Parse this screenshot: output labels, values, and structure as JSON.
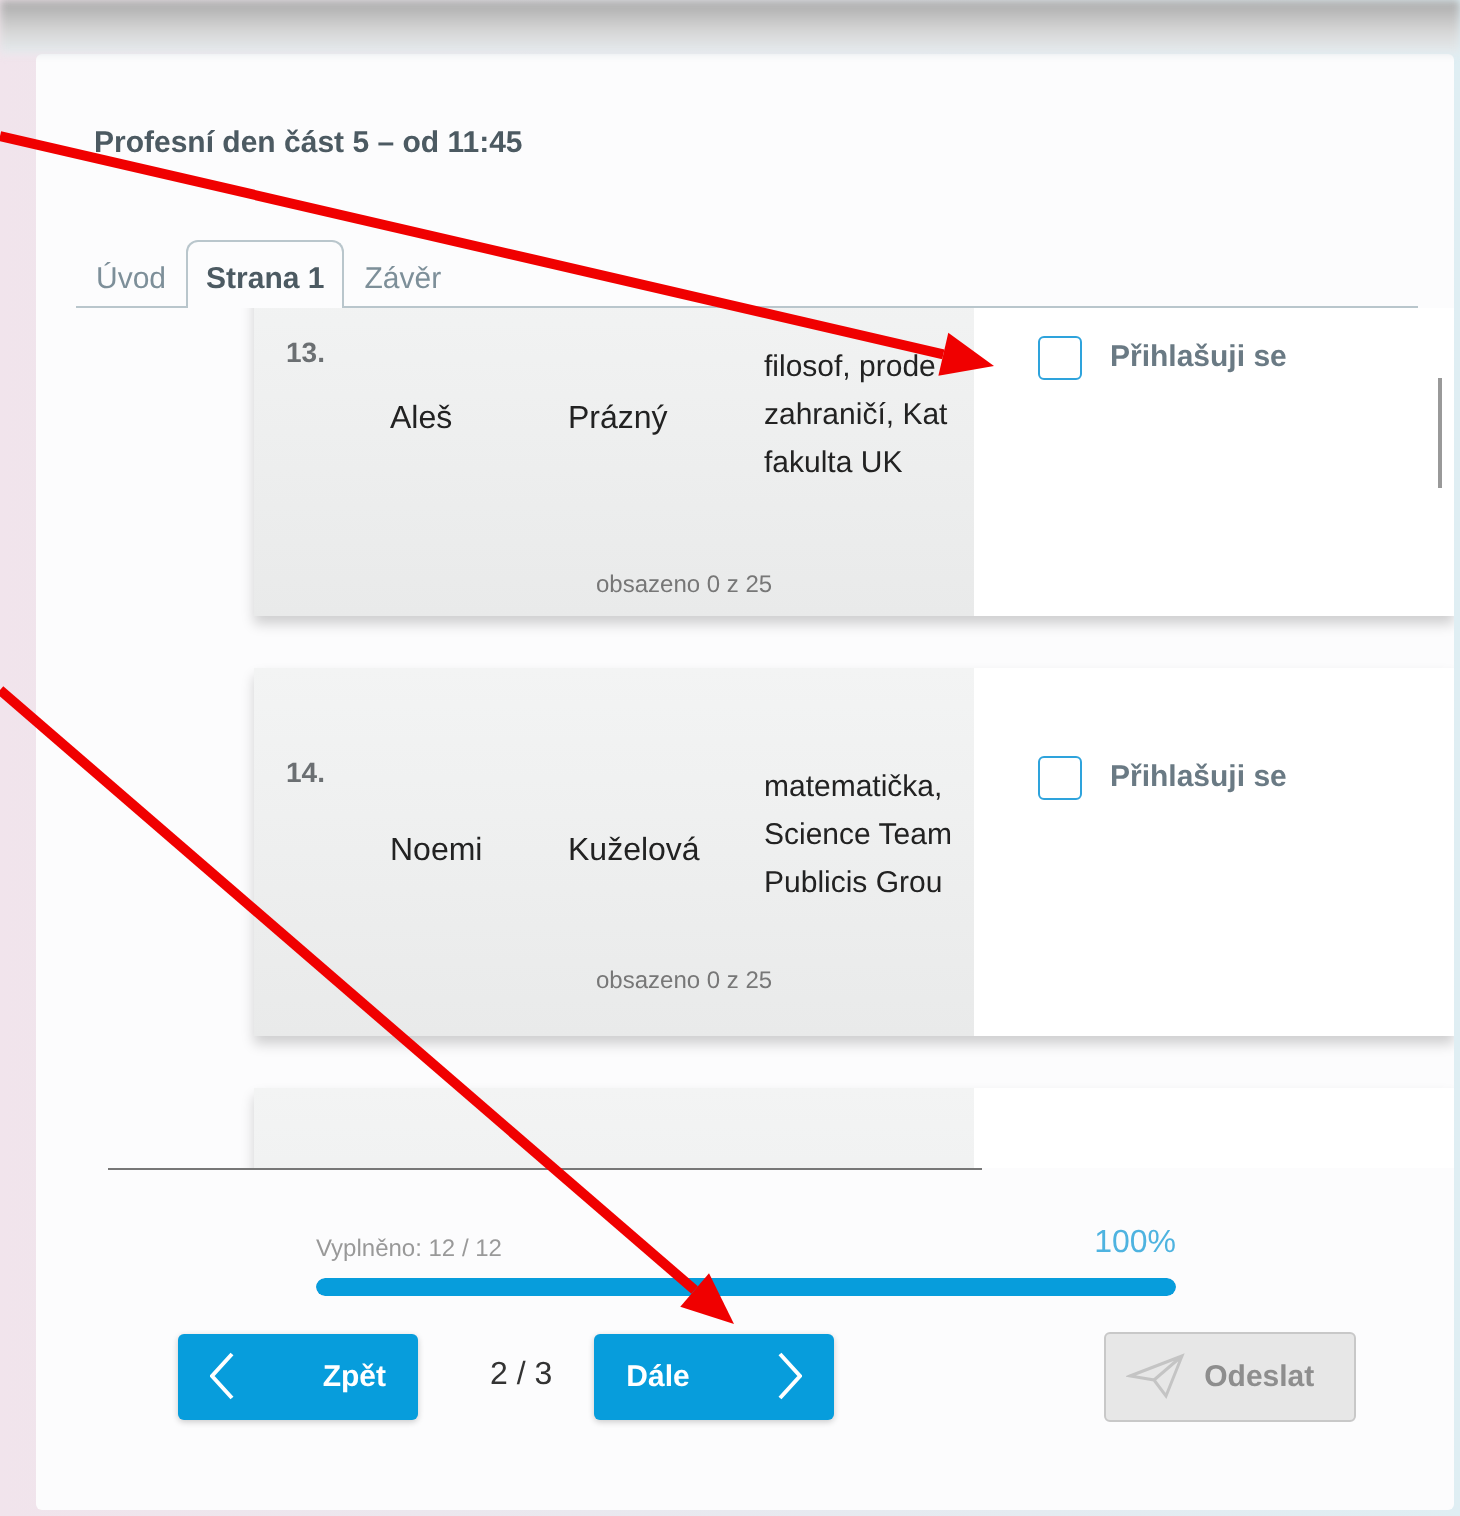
{
  "title": "Profesní den část 5 – od 11:45",
  "tabs": [
    {
      "label": "Úvod",
      "selected": false
    },
    {
      "label": "Strana 1",
      "selected": true
    },
    {
      "label": "Závěr",
      "selected": false
    }
  ],
  "speakers": [
    {
      "number": "13.",
      "first_name": "Aleš",
      "last_name": "Prázný",
      "description_lines": [
        "filosof, prode",
        "zahraničí, Kat",
        "fakulta UK"
      ],
      "capacity": "obsazeno 0 z 25",
      "signup_label": "Přihlašuji se",
      "checked": false
    },
    {
      "number": "14.",
      "first_name": "Noemi",
      "last_name": "Kuželová",
      "description_lines": [
        "matematička,",
        "Science Team",
        "Publicis Grou"
      ],
      "capacity": "obsazeno 0 z 25",
      "signup_label": "Přihlašuji se",
      "checked": false
    }
  ],
  "progress": {
    "label": "Vyplněno: 12 / 12",
    "percent": "100%",
    "level": 1
  },
  "nav": {
    "back": "Zpět",
    "page": "2 / 3",
    "next": "Dále",
    "submit": "Odeslat",
    "submit_disabled": true
  }
}
